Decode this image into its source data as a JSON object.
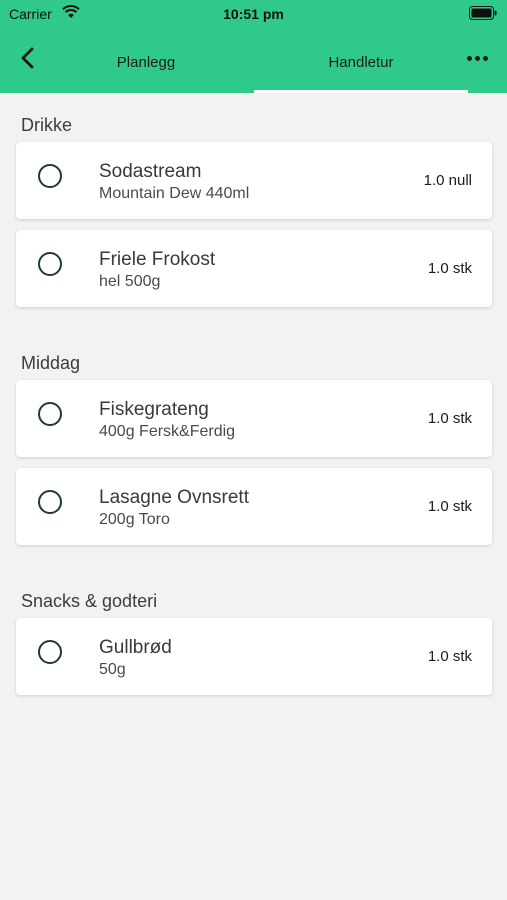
{
  "status_bar": {
    "carrier": "Carrier",
    "time": "10:51 pm"
  },
  "nav": {
    "back_icon": "chevron-left-icon",
    "tabs": [
      {
        "label": "Planlegg",
        "active": false
      },
      {
        "label": "Handletur",
        "active": true
      }
    ],
    "more_icon": "more-horizontal-icon"
  },
  "colors": {
    "header_bg": "#2fc98c",
    "page_bg": "#f2f2f2",
    "card_bg": "#ffffff",
    "checkbox_border": "#1f3b34"
  },
  "sections": [
    {
      "title": "Drikke",
      "items": [
        {
          "name": "Sodastream",
          "description": "Mountain Dew 440ml",
          "quantity": "1.0 null",
          "checked": false
        },
        {
          "name": "Friele Frokost",
          "description": "hel 500g",
          "quantity": "1.0 stk",
          "checked": false
        }
      ]
    },
    {
      "title": "Middag",
      "items": [
        {
          "name": "Fiskegrateng",
          "description": "400g Fersk&Ferdig",
          "quantity": "1.0 stk",
          "checked": false
        },
        {
          "name": "Lasagne Ovnsrett",
          "description": "200g Toro",
          "quantity": "1.0 stk",
          "checked": false
        }
      ]
    },
    {
      "title": "Snacks & godteri",
      "items": [
        {
          "name": "Gullbrød",
          "description": "50g",
          "quantity": "1.0 stk",
          "checked": false
        }
      ]
    }
  ]
}
